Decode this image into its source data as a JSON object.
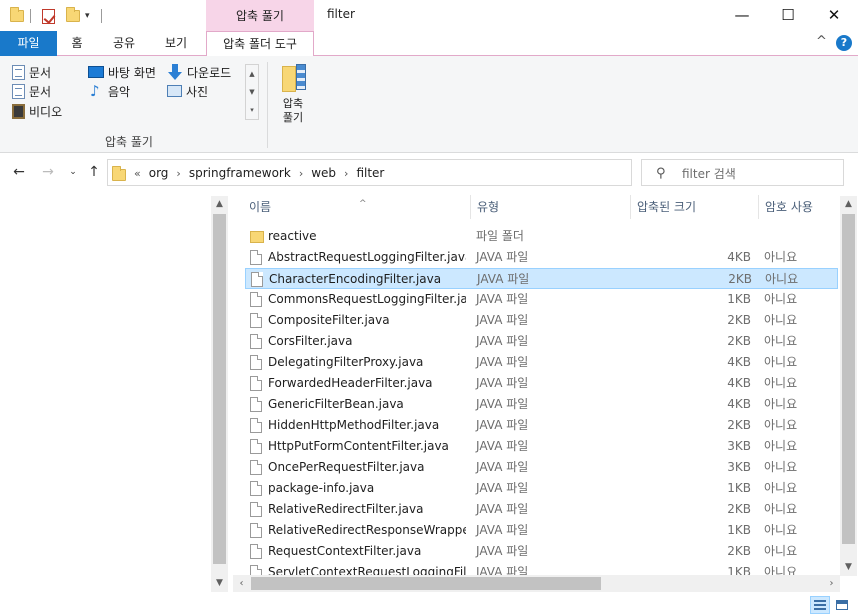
{
  "window": {
    "title": "filter",
    "context_tab_header": "압축 풀기",
    "minimize_glyph": "—",
    "maximize_glyph": "☐",
    "close_glyph": "✕"
  },
  "ribbon_tabs": {
    "file": "파일",
    "home": "홈",
    "share": "공유",
    "view": "보기",
    "compressed_tools": "압축 폴더 도구",
    "collapse_glyph": "^",
    "help_glyph": "?"
  },
  "ribbon": {
    "destinations": [
      {
        "label": "문서",
        "icon": "document-icon"
      },
      {
        "label": "바탕 화면",
        "icon": "desktop-icon"
      },
      {
        "label": "다운로드",
        "icon": "download-icon"
      },
      {
        "label": "문서",
        "icon": "document-icon"
      },
      {
        "label": "음악",
        "icon": "music-icon"
      },
      {
        "label": "사진",
        "icon": "pictures-icon"
      },
      {
        "label": "비디오",
        "icon": "video-icon"
      }
    ],
    "group_label": "압축 풀기",
    "extract_all_line1": "압축",
    "extract_all_line2": "풀기"
  },
  "address": {
    "overflow": "«",
    "crumbs": [
      "org",
      "springframework",
      "web",
      "filter"
    ],
    "separator": "›"
  },
  "search": {
    "placeholder": "filter 검색"
  },
  "columns": {
    "name": "이름",
    "type": "유형",
    "compressed_size": "압축된 크기",
    "password": "암호 사용"
  },
  "files": [
    {
      "name": "reactive",
      "type": "파일 폴더",
      "size": "",
      "password": "",
      "kind": "folder"
    },
    {
      "name": "AbstractRequestLoggingFilter.java",
      "type": "JAVA 파일",
      "size": "4KB",
      "password": "아니요",
      "kind": "file"
    },
    {
      "name": "CharacterEncodingFilter.java",
      "type": "JAVA 파일",
      "size": "2KB",
      "password": "아니요",
      "kind": "file",
      "selected": true
    },
    {
      "name": "CommonsRequestLoggingFilter.java",
      "type": "JAVA 파일",
      "size": "1KB",
      "password": "아니요",
      "kind": "file"
    },
    {
      "name": "CompositeFilter.java",
      "type": "JAVA 파일",
      "size": "2KB",
      "password": "아니요",
      "kind": "file"
    },
    {
      "name": "CorsFilter.java",
      "type": "JAVA 파일",
      "size": "2KB",
      "password": "아니요",
      "kind": "file"
    },
    {
      "name": "DelegatingFilterProxy.java",
      "type": "JAVA 파일",
      "size": "4KB",
      "password": "아니요",
      "kind": "file"
    },
    {
      "name": "ForwardedHeaderFilter.java",
      "type": "JAVA 파일",
      "size": "4KB",
      "password": "아니요",
      "kind": "file"
    },
    {
      "name": "GenericFilterBean.java",
      "type": "JAVA 파일",
      "size": "4KB",
      "password": "아니요",
      "kind": "file"
    },
    {
      "name": "HiddenHttpMethodFilter.java",
      "type": "JAVA 파일",
      "size": "2KB",
      "password": "아니요",
      "kind": "file"
    },
    {
      "name": "HttpPutFormContentFilter.java",
      "type": "JAVA 파일",
      "size": "3KB",
      "password": "아니요",
      "kind": "file"
    },
    {
      "name": "OncePerRequestFilter.java",
      "type": "JAVA 파일",
      "size": "3KB",
      "password": "아니요",
      "kind": "file"
    },
    {
      "name": "package-info.java",
      "type": "JAVA 파일",
      "size": "1KB",
      "password": "아니요",
      "kind": "file"
    },
    {
      "name": "RelativeRedirectFilter.java",
      "type": "JAVA 파일",
      "size": "2KB",
      "password": "아니요",
      "kind": "file"
    },
    {
      "name": "RelativeRedirectResponseWrapper.j...",
      "type": "JAVA 파일",
      "size": "1KB",
      "password": "아니요",
      "kind": "file"
    },
    {
      "name": "RequestContextFilter.java",
      "type": "JAVA 파일",
      "size": "2KB",
      "password": "아니요",
      "kind": "file"
    },
    {
      "name": "ServletContextRequestLoggingFilt...",
      "type": "JAVA 파일",
      "size": "1KB",
      "password": "아니요",
      "kind": "file"
    }
  ]
}
